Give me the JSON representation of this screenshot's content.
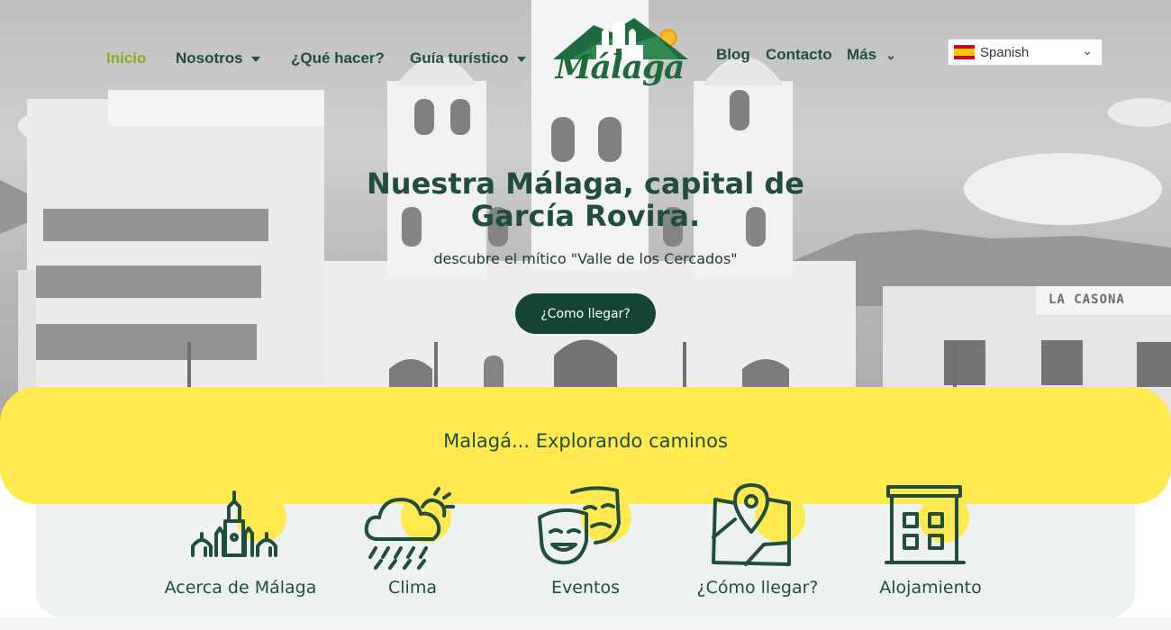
{
  "nav": {
    "items": [
      {
        "label": "Inicio",
        "active": true
      },
      {
        "label": "Nosotros",
        "has_caret": true
      },
      {
        "label": "¿Qué hacer?"
      },
      {
        "label": "Guía turístico",
        "has_caret": true
      },
      {
        "label": "Blog"
      },
      {
        "label": "Contacto"
      },
      {
        "label": "Más",
        "has_chevron": true
      }
    ],
    "active_color": "#8bb01e",
    "text_color": "#1f4e3f"
  },
  "logo": {
    "text": "Málaga",
    "icon": "church-mountain-logo"
  },
  "language": {
    "selected": "Spanish",
    "flag_icon": "spain-flag-icon"
  },
  "hero": {
    "title": "Nuestra Málaga, capital de García Rovira.",
    "subtitle": "descubre el mítico \"Valle de los Cercados\"",
    "cta_label": "¿Como llegar?",
    "background_sign": "LA CASONA"
  },
  "band": {
    "title": "Malagá... Explorando caminos",
    "color": "#ffe94e"
  },
  "cards": [
    {
      "label": "Acerca de Málaga",
      "icon": "church-icon"
    },
    {
      "label": "Clima",
      "icon": "weather-icon"
    },
    {
      "label": "Eventos",
      "icon": "theater-masks-icon"
    },
    {
      "label": "¿Cómo llegar?",
      "icon": "map-pin-icon"
    },
    {
      "label": "Alojamiento",
      "icon": "building-icon"
    }
  ],
  "colors": {
    "primary": "#164437",
    "accent_yellow": "#ffe94e",
    "card_bg": "#edf1ef"
  }
}
